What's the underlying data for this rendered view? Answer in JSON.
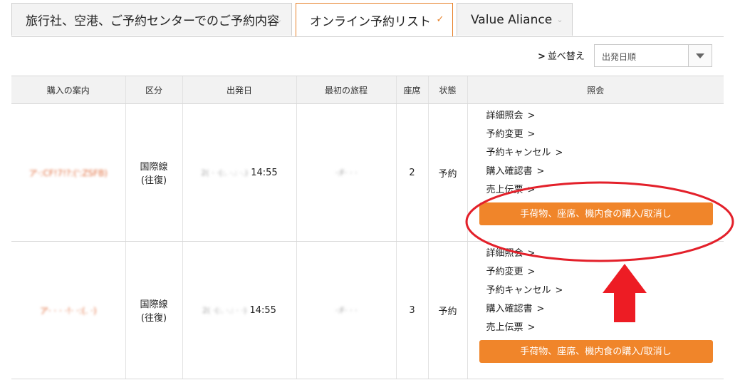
{
  "tabs": [
    {
      "label": "旅行社、空港、ご予約センターでのご予約内容",
      "active": false
    },
    {
      "label": "オンライン予約リスト",
      "active": true
    },
    {
      "label": "Value Aliance",
      "active": false
    }
  ],
  "sort": {
    "label": "並べ替え",
    "arrow": ">",
    "selected": "出発日順"
  },
  "table": {
    "headers": [
      "購入の案内",
      "区分",
      "出発日",
      "最初の旅程",
      "座席",
      "状態",
      "照会"
    ],
    "rows": [
      {
        "purchase_info": "ア·:CF!7!?:(':ZSFB)",
        "category_line1": "国際線",
        "category_line2": "(往復)",
        "departure_prefix": "2( · ·(:. ·.: ·.)",
        "departure_time": "14:55",
        "first_itinerary": "·:F· · ·",
        "seats": "2",
        "status": "予約",
        "links": [
          "詳細照会",
          "予約変更",
          "予約キャンセル",
          "購入確認書",
          "売上伝票"
        ],
        "action": "手荷物、座席、機内食の購入/取消し"
      },
      {
        "purchase_info": "ア· · · ·!· ·:(. ·)",
        "category_line1": "国際線",
        "category_line2": "(往復)",
        "departure_prefix": "2( ·(:. ·.: · ·)",
        "departure_time": "14:55",
        "first_itinerary": "·:F· · ·",
        "seats": "3",
        "status": "予約",
        "links": [
          "詳細照会",
          "予約変更",
          "予約キャンセル",
          "購入確認書",
          "売上伝票"
        ],
        "action": "手荷物、座席、機内食の購入/取消し"
      }
    ]
  },
  "colors": {
    "accent": "#f0852a",
    "annotation": "#e3202a"
  },
  "icons": {
    "tab_chevron": "chevron-down-icon",
    "sort_arrow": "chevron-right-icon",
    "select_caret": "caret-down-icon"
  }
}
